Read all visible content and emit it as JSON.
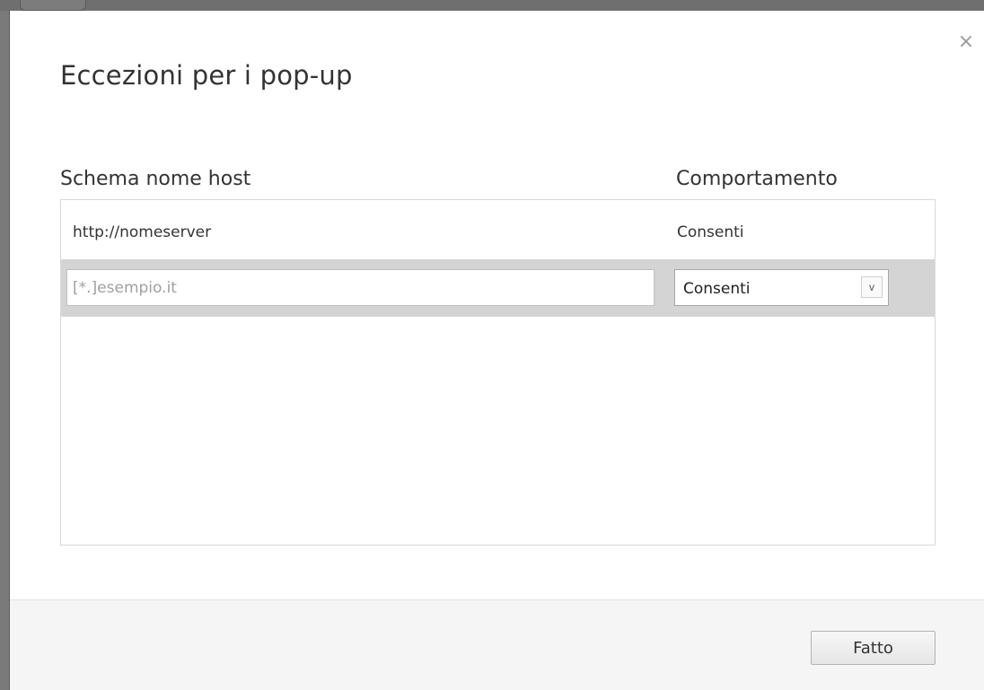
{
  "dialog": {
    "title": "Eccezioni per i pop-up",
    "close_glyph": "×"
  },
  "columns": {
    "host": "Schema nome host",
    "behavior": "Comportamento"
  },
  "exceptions": [
    {
      "host": "http://nomeserver",
      "behavior": "Consenti"
    }
  ],
  "new_entry": {
    "host_value": "",
    "host_placeholder": "[*.]esempio.it",
    "behavior_selected": "Consenti",
    "dropdown_glyph": "v"
  },
  "footer": {
    "done_label": "Fatto"
  }
}
